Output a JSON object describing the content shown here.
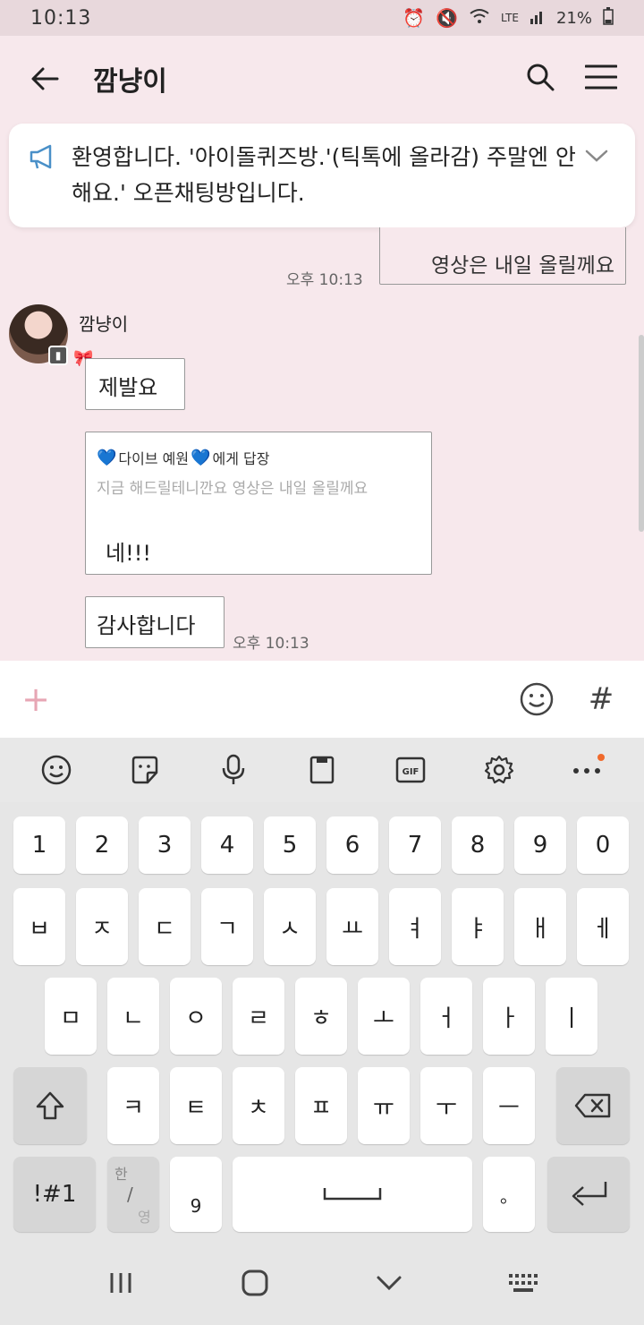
{
  "status": {
    "time": "10:13",
    "network": "LTE",
    "battery": "21%"
  },
  "header": {
    "title": "깜냥이"
  },
  "notice": {
    "text": "환영합니다. '아이돌퀴즈방.'(틱톡에 올라감) 주말엔 안해요.' 오픈채팅방입니다."
  },
  "chat": {
    "prev_bubble": "영상은 내일 올릴께요",
    "prev_time": "오후 10:13",
    "sender": "깜냥이",
    "msg1": "제발요",
    "reply": {
      "header_name": "다이브 예원",
      "header_suffix": "에게 답장",
      "quote": "지금 해드릴테니깐요 영상은 내일 올릴께요",
      "message": "네!!!"
    },
    "msg3": "감사합니다",
    "msg3_time": "오후 10:13"
  },
  "input": {
    "plus": "+",
    "hash": "#"
  },
  "keyboard": {
    "numbers": [
      "1",
      "2",
      "3",
      "4",
      "5",
      "6",
      "7",
      "8",
      "9",
      "0"
    ],
    "row1": [
      "ㅂ",
      "ㅈ",
      "ㄷ",
      "ㄱ",
      "ㅅ",
      "ㅛ",
      "ㅕ",
      "ㅑ",
      "ㅐ",
      "ㅔ"
    ],
    "row2": [
      "ㅁ",
      "ㄴ",
      "ㅇ",
      "ㄹ",
      "ㅎ",
      "ㅗ",
      "ㅓ",
      "ㅏ",
      "ㅣ"
    ],
    "row3": [
      "ㅋ",
      "ㅌ",
      "ㅊ",
      "ㅍ",
      "ㅠ",
      "ㅜ",
      "ㅡ"
    ],
    "symbols": "!#1",
    "lang_top": "한",
    "lang_bottom": "영",
    "comma": "9",
    "period": "。"
  },
  "colors": {
    "accent": "#e7a6b4",
    "background": "#f7e8ec"
  }
}
